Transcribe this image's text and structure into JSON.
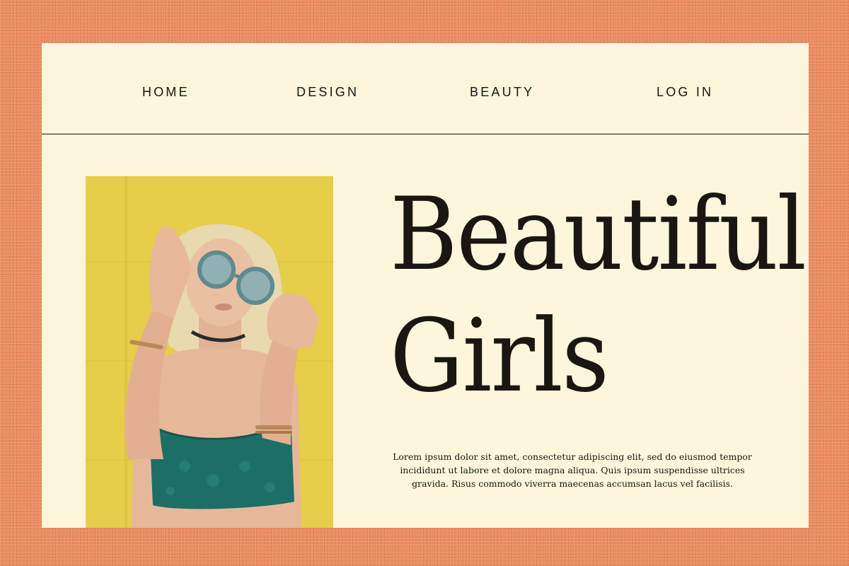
{
  "nav": {
    "items": [
      {
        "label": "HOME"
      },
      {
        "label": "DESIGN"
      },
      {
        "label": "BEAUTY"
      },
      {
        "label": "LOG IN"
      }
    ]
  },
  "hero": {
    "title_line_1": "Beautiful",
    "title_line_2": "Girls",
    "description": "Lorem ipsum dolor sit amet, consectetur adipiscing elit, sed do eiusmod tempor incididunt ut labore et dolore magna aliqua. Quis ipsum suspendisse ultrices gravida. Risus commodo viverra maecenas accumsan lacus vel facilisis."
  },
  "colors": {
    "background": "#e9895f",
    "page": "#fdf6dc",
    "text": "#1a1712",
    "photo_wall": "#e8cf4c",
    "top_teal": "#1d6f66"
  }
}
